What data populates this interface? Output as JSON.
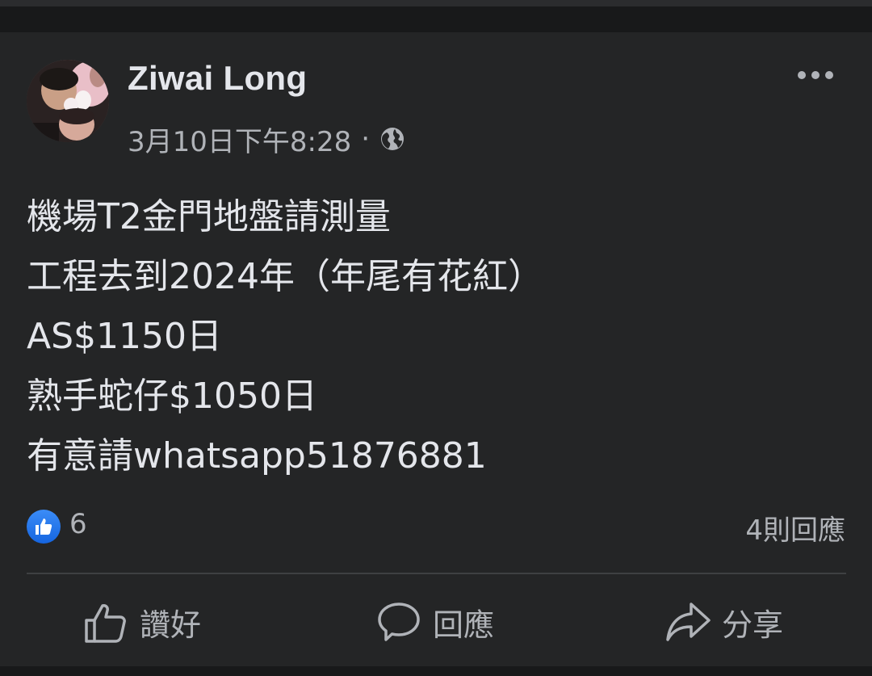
{
  "post": {
    "author": "Ziwai Long",
    "timestamp": "3月10日下午8:28",
    "separator": "·",
    "privacy_icon": "globe-icon",
    "more_icon": "more-options-icon",
    "lines": [
      "機場T2金門地盤請測量",
      "工程去到2024年（年尾有花紅）",
      "AS$1150日",
      "熟手蛇仔$1050日",
      "有意請whatsapp51876881"
    ]
  },
  "stats": {
    "reaction_icon": "like-reaction-icon",
    "like_count": "6",
    "comment_count": "4則回應"
  },
  "actions": {
    "like_label": "讚好",
    "comment_label": "回應",
    "share_label": "分享"
  },
  "colors": {
    "background": "#18191a",
    "card": "#242526",
    "primary_text": "#e4e6eb",
    "secondary_text": "#b0b3b8",
    "like_blue": "#1877f2",
    "divider": "#3e4042"
  }
}
